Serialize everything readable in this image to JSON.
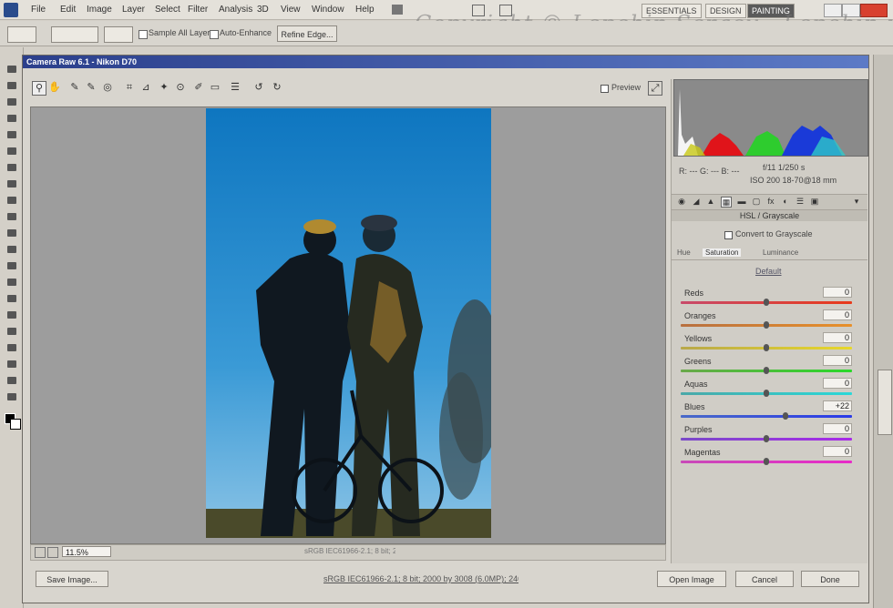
{
  "menubar": {
    "items": [
      "File",
      "Edit",
      "Image",
      "Layer",
      "Select",
      "Filter",
      "Analysis",
      "3D",
      "View",
      "Window",
      "Help"
    ],
    "workspace_buttons": [
      "ESSENTIALS",
      "DESIGN",
      "PAINTING"
    ],
    "active_workspace": "PAINTING"
  },
  "watermark": "Copyright © Lepehin Sergey - Lepehin.ru",
  "optionsbar": {
    "sample_all_layers": "Sample All Layers",
    "auto_enhance": "Auto-Enhance",
    "refine_edge": "Refine Edge..."
  },
  "dialog": {
    "title": "Camera Raw 6.1 - Nikon D70",
    "preview_label": "Preview",
    "zoom_value": "11.5%",
    "status_link": "sRGB IEC61966-2.1; 8 bit; 2000 by 3008 (6.0MP); 240 ppi",
    "workflow_text": "sRGB IEC61966-2.1; 8 bit; 2000 by 3008 (6.0MP); 240 ppi",
    "buttons": {
      "save": "Save Image...",
      "open": "Open Image",
      "cancel": "Cancel",
      "done": "Done"
    }
  },
  "histogram": {
    "readout_left": "R:  ---    G:  ---    B:  ---",
    "readout_center": "f/11  1/250 s",
    "readout_center2": "ISO 200  18-70@18 mm"
  },
  "panel": {
    "title": "HSL / Grayscale",
    "convert_label": "Convert to Grayscale",
    "subtabs": [
      "Hue",
      "Saturation",
      "Luminance"
    ],
    "default_link": "Default",
    "sliders": [
      {
        "label": "Reds",
        "value": "0",
        "level": 0.5
      },
      {
        "label": "Oranges",
        "value": "0",
        "level": 0.5
      },
      {
        "label": "Yellows",
        "value": "0",
        "level": 0.5
      },
      {
        "label": "Greens",
        "value": "0",
        "level": 0.5
      },
      {
        "label": "Aquas",
        "value": "0",
        "level": 0.5
      },
      {
        "label": "Blues",
        "value": "+22",
        "level": 0.61
      },
      {
        "label": "Purples",
        "value": "0",
        "level": 0.5
      },
      {
        "label": "Magentas",
        "value": "0",
        "level": 0.5
      }
    ]
  },
  "colors": {
    "accent_title": "#2b3f8c",
    "sky": "#1f88c8"
  }
}
